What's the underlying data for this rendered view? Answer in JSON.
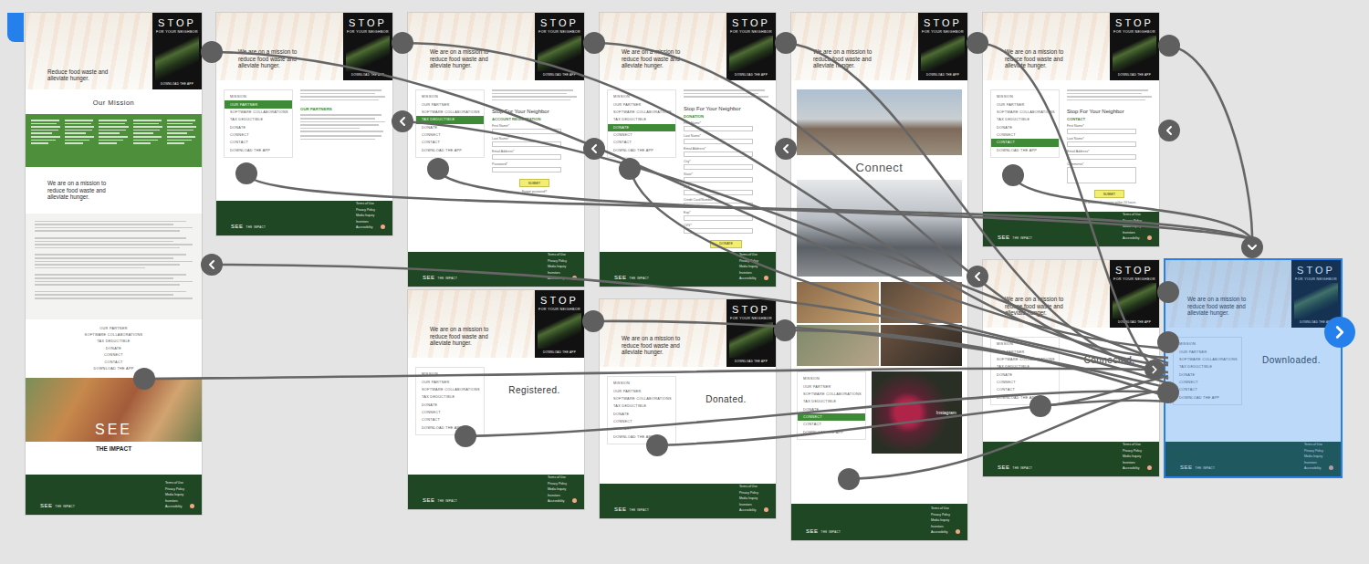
{
  "logo": {
    "title": "STOP",
    "subtitle": "FOR YOUR NEIGHBOR",
    "cta": "DOWNLOAD THE APP"
  },
  "footer": {
    "brand": "SEE",
    "tag": "THE IMPACT",
    "links": [
      "Terms of Use",
      "Privacy Policy",
      "Media Inquiry",
      "Investors",
      "Accessibility"
    ]
  },
  "artboards": [
    {
      "kind": "home",
      "selected": false,
      "tagline": "Reduce food waste and alleviate hunger.",
      "heading": "Our Mission",
      "subheading": "We are on a mission to reduce food waste and alleviate hunger.",
      "menu": [
        {
          "label": "OUR PARTNER",
          "selected": false
        },
        {
          "label": "SOFTWARE COLLABORATIONS",
          "selected": false
        },
        {
          "label": "TAX DEDUCTIBLE",
          "selected": false
        },
        {
          "label": "DONATE",
          "selected": false
        },
        {
          "label": "CONNECT",
          "selected": false
        },
        {
          "label": "CONTACT",
          "selected": false
        },
        {
          "label": "DOWNLOAD THE APP",
          "selected": false
        }
      ],
      "impact": {
        "title": "SEE",
        "subtitle": "THE IMPACT"
      }
    },
    {
      "kind": "page",
      "selected": false,
      "tagline": "We are on a mission to reduce food waste and alleviate hunger.",
      "heading": "OUR PARTNERS",
      "menu": [
        {
          "label": "MISSION",
          "selected": false
        },
        {
          "label": "OUR PARTNER",
          "selected": true
        },
        {
          "label": "SOFTWARE COLLABORATIONS",
          "selected": false
        },
        {
          "label": "TAX DEDUCTIBLE",
          "selected": false
        },
        {
          "label": "DONATE",
          "selected": false
        },
        {
          "label": "CONNECT",
          "selected": false
        },
        {
          "label": "CONTACT",
          "selected": false
        },
        {
          "label": "DOWNLOAD THE APP",
          "selected": false
        }
      ]
    },
    {
      "kind": "form",
      "selected": false,
      "tagline": "We are on a mission to reduce food waste and alleviate hunger.",
      "title": "Stop For Your Neighbor",
      "subtitle": "ACCOUNT REGISTRATION",
      "fields": [
        {
          "label": "First Name*",
          "kind": "text"
        },
        {
          "label": "Last Name*",
          "kind": "text"
        },
        {
          "label": "Email Address*",
          "kind": "text"
        },
        {
          "label": "Password*",
          "kind": "text"
        }
      ],
      "button": "SUBMIT",
      "note": "Forgot password?",
      "menu": [
        {
          "label": "MISSION",
          "selected": false
        },
        {
          "label": "OUR PARTNER",
          "selected": false
        },
        {
          "label": "SOFTWARE COLLABORATIONS",
          "selected": false
        },
        {
          "label": "TAX DEDUCTIBLE",
          "selected": true
        },
        {
          "label": "DONATE",
          "selected": false
        },
        {
          "label": "CONNECT",
          "selected": false
        },
        {
          "label": "CONTACT",
          "selected": false
        },
        {
          "label": "DOWNLOAD THE APP",
          "selected": false
        }
      ]
    },
    {
      "kind": "form",
      "selected": false,
      "tagline": "We are on a mission to reduce food waste and alleviate hunger.",
      "title": "Stop For Your Neighbor",
      "subtitle": "DONATION",
      "fields": [
        {
          "label": "First Name*",
          "kind": "text"
        },
        {
          "label": "Last Name*",
          "kind": "text"
        },
        {
          "label": "Email Address*",
          "kind": "text"
        },
        {
          "label": "City*",
          "kind": "text"
        },
        {
          "label": "State*",
          "kind": "text"
        },
        {
          "label": "Zip*",
          "kind": "text"
        },
        {
          "label": "Credit Card Number*",
          "kind": "text"
        },
        {
          "label": "Exp*",
          "kind": "text"
        },
        {
          "label": "CVV*",
          "kind": "text"
        }
      ],
      "button": "DONATE",
      "note": "",
      "menu": [
        {
          "label": "MISSION",
          "selected": false
        },
        {
          "label": "OUR PARTNER",
          "selected": false
        },
        {
          "label": "SOFTWARE COLLABORATIONS",
          "selected": false
        },
        {
          "label": "TAX DEDUCTIBLE",
          "selected": false
        },
        {
          "label": "DONATE",
          "selected": true
        },
        {
          "label": "CONNECT",
          "selected": false
        },
        {
          "label": "CONTACT",
          "selected": false
        },
        {
          "label": "DOWNLOAD THE APP",
          "selected": false
        }
      ]
    },
    {
      "kind": "gallery",
      "selected": false,
      "tagline": "We are on a mission to reduce food waste and alleviate hunger.",
      "heading": "Connect",
      "photo_label": "Instagram",
      "menu": [
        {
          "label": "MISSION",
          "selected": false
        },
        {
          "label": "OUR PARTNER",
          "selected": false
        },
        {
          "label": "SOFTWARE COLLABORATIONS",
          "selected": false
        },
        {
          "label": "TAX DEDUCTIBLE",
          "selected": false
        },
        {
          "label": "DONATE",
          "selected": false
        },
        {
          "label": "CONNECT",
          "selected": true
        },
        {
          "label": "CONTACT",
          "selected": false
        },
        {
          "label": "DOWNLOAD THE APP",
          "selected": false
        }
      ]
    },
    {
      "kind": "form",
      "selected": false,
      "tagline": "We are on a mission to reduce food waste and alleviate hunger.",
      "title": "Stop For Your Neighbor",
      "subtitle": "CONTACT",
      "fields": [
        {
          "label": "First Name*",
          "kind": "text"
        },
        {
          "label": "Last Name*",
          "kind": "text"
        },
        {
          "label": "Email Address*",
          "kind": "text"
        },
        {
          "label": "Comments*",
          "kind": "textarea"
        }
      ],
      "button": "SUBMIT",
      "note": "We answer all inquiries within 24 hours.",
      "menu": [
        {
          "label": "MISSION",
          "selected": false
        },
        {
          "label": "OUR PARTNER",
          "selected": false
        },
        {
          "label": "SOFTWARE COLLABORATIONS",
          "selected": false
        },
        {
          "label": "TAX DEDUCTIBLE",
          "selected": false
        },
        {
          "label": "DONATE",
          "selected": false
        },
        {
          "label": "CONNECT",
          "selected": false
        },
        {
          "label": "CONTACT",
          "selected": true
        },
        {
          "label": "DOWNLOAD THE APP",
          "selected": false
        }
      ]
    },
    {
      "kind": "confirm",
      "selected": false,
      "tagline": "We are on a mission to reduce food waste and alleviate hunger.",
      "message": "Registered.",
      "menu": [
        {
          "label": "MISSION",
          "selected": false
        },
        {
          "label": "OUR PARTNER",
          "selected": false
        },
        {
          "label": "SOFTWARE COLLABORATIONS",
          "selected": false
        },
        {
          "label": "TAX DEDUCTIBLE",
          "selected": false
        },
        {
          "label": "DONATE",
          "selected": false
        },
        {
          "label": "CONNECT",
          "selected": false
        },
        {
          "label": "CONTACT",
          "selected": false
        },
        {
          "label": "DOWNLOAD THE APP",
          "selected": false
        }
      ]
    },
    {
      "kind": "confirm",
      "selected": false,
      "tagline": "We are on a mission to reduce food waste and alleviate hunger.",
      "message": "Donated.",
      "menu": [
        {
          "label": "MISSION",
          "selected": false
        },
        {
          "label": "OUR PARTNER",
          "selected": false
        },
        {
          "label": "SOFTWARE COLLABORATIONS",
          "selected": false
        },
        {
          "label": "TAX DEDUCTIBLE",
          "selected": false
        },
        {
          "label": "DONATE",
          "selected": false
        },
        {
          "label": "CONNECT",
          "selected": false
        },
        {
          "label": "CONTACT",
          "selected": false
        },
        {
          "label": "DOWNLOAD THE APP",
          "selected": false
        }
      ]
    },
    {
      "kind": "confirm",
      "selected": false,
      "tagline": "We are on a mission to reduce food waste and alleviate hunger.",
      "message": "Connected.",
      "menu": [
        {
          "label": "MISSION",
          "selected": false
        },
        {
          "label": "OUR PARTNER",
          "selected": false
        },
        {
          "label": "SOFTWARE COLLABORATIONS",
          "selected": false
        },
        {
          "label": "TAX DEDUCTIBLE",
          "selected": false
        },
        {
          "label": "DONATE",
          "selected": false
        },
        {
          "label": "CONNECT",
          "selected": false
        },
        {
          "label": "CONTACT",
          "selected": false
        },
        {
          "label": "DOWNLOAD THE APP",
          "selected": false
        }
      ]
    },
    {
      "kind": "confirm",
      "selected": true,
      "tagline": "We are on a mission to reduce food waste and alleviate hunger.",
      "message": "Downloaded.",
      "menu": [
        {
          "label": "MISSION",
          "selected": false
        },
        {
          "label": "OUR PARTNER",
          "selected": false
        },
        {
          "label": "SOFTWARE COLLABORATIONS",
          "selected": false
        },
        {
          "label": "TAX DEDUCTIBLE",
          "selected": false
        },
        {
          "label": "DONATE",
          "selected": false
        },
        {
          "label": "CONNECT",
          "selected": false
        },
        {
          "label": "CONTACT",
          "selected": false
        },
        {
          "label": "DOWNLOAD THE APP",
          "selected": false
        }
      ]
    }
  ]
}
